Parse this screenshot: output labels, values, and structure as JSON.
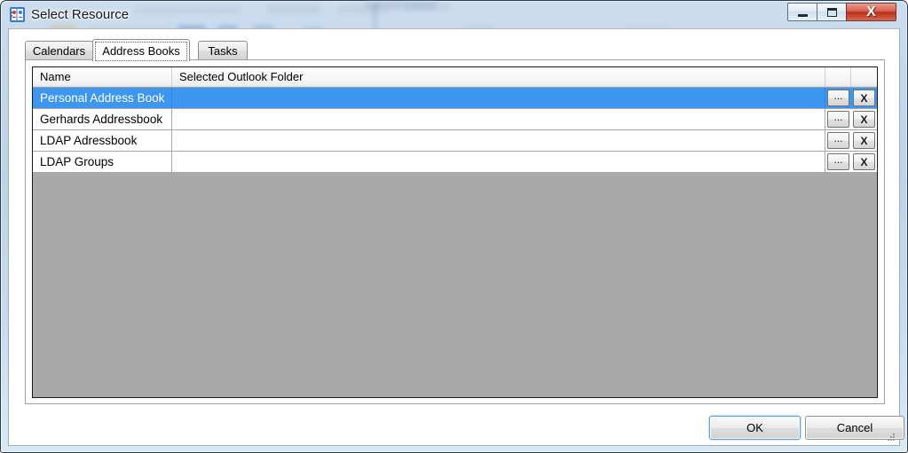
{
  "window": {
    "title": "Select Resource",
    "icon": "address-book-icon",
    "controls": {
      "minimize": "minimize-icon",
      "maximize": "maximize-icon",
      "close": "X"
    }
  },
  "tabs": [
    {
      "label": "Calendars",
      "selected": false
    },
    {
      "label": "Address Books",
      "selected": true
    },
    {
      "label": "Tasks",
      "selected": false
    }
  ],
  "grid": {
    "columns": [
      {
        "label": "Name"
      },
      {
        "label": "Selected Outlook Folder"
      },
      {
        "label": ""
      },
      {
        "label": ""
      }
    ],
    "rows": [
      {
        "name": "Personal Address Book",
        "folder": "",
        "browse_label": "...",
        "clear_label": "X",
        "selected": true
      },
      {
        "name": "Gerhards Addressbook",
        "folder": "",
        "browse_label": "...",
        "clear_label": "X",
        "selected": false
      },
      {
        "name": "LDAP Adressbook",
        "folder": "",
        "browse_label": "...",
        "clear_label": "X",
        "selected": false
      },
      {
        "name": "LDAP Groups",
        "folder": "",
        "browse_label": "...",
        "clear_label": "X",
        "selected": false
      }
    ]
  },
  "footer": {
    "ok_label": "OK",
    "cancel_label": "Cancel"
  },
  "colors": {
    "selection_blue": "#3d96f0",
    "grid_empty_gray": "#a9a9a9",
    "close_red": "#b92f1c",
    "focus_blue": "#5ba0d8"
  }
}
